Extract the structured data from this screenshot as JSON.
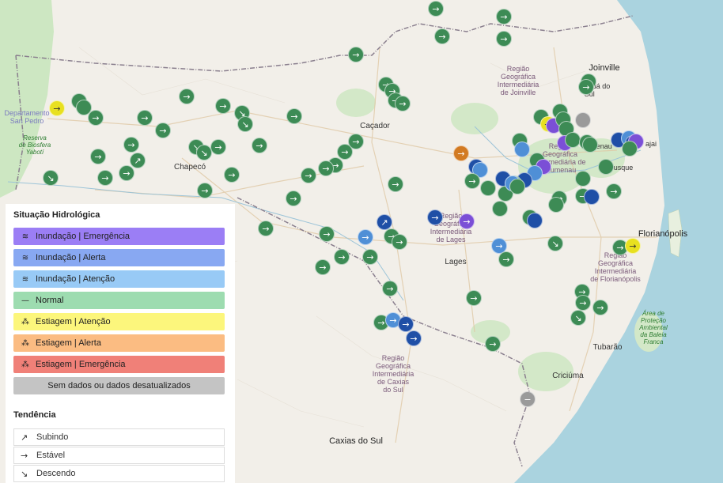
{
  "colors": {
    "normal": "#3d8b55",
    "emergencia_inund": "#7b4fd6",
    "alerta_inund": "#1f4fa6",
    "atencao_inund": "#4f8fd6",
    "estiagem_atencao": "#e8e020",
    "estiagem_alerta": "#d27a22",
    "sem_dados": "#9a9a9a"
  },
  "map_labels": {
    "regions": [
      {
        "text": "Região\nGeográfica\nIntermediária\nde Joinville"
      },
      {
        "text": "Região\nGeográfica\nIntermediária de\nBlumenau"
      },
      {
        "text": "Região\nGeográfica\nIntermediária\nde Lages"
      },
      {
        "text": "Região\nGeográfica\nIntermediária\nde Florianópolis"
      },
      {
        "text": "Região\nGeográfica\nIntermediária\nde Caxias\ndo Sul"
      }
    ],
    "cities": {
      "joinville": "Joinville",
      "jaragua": "aguá do\nSul",
      "cacador": "Caçador",
      "chapeco": "Chapecó",
      "lages": "Lages",
      "florianopolis": "Florianópolis",
      "tubarao": "Tubarão",
      "criciuma": "Criciúma",
      "caxias": "Caxias do Sul",
      "departamento": "Departamento\nSan Pedro",
      "usque": "usque",
      "menau": "menau",
      "ajai": "ajai"
    },
    "reserves": {
      "biosfera": "Reserva\nde Biosfera\nYabotí",
      "baleia": "Área de\nProteção\nAmbiental\nda Baleia\nFranca"
    }
  },
  "legend": {
    "title": "Situação Hidrológica",
    "items": [
      {
        "label": "Inundação | Emergência",
        "color": "#9b7ef5",
        "icon": "flood-icon"
      },
      {
        "label": "Inundação | Alerta",
        "color": "#88a8f2",
        "icon": "flood-icon"
      },
      {
        "label": "Inundação | Atenção",
        "color": "#98caf6",
        "icon": "flood-icon"
      },
      {
        "label": "Normal",
        "color": "#9ddcb0",
        "icon": "dash-icon"
      },
      {
        "label": "Estiagem | Atenção",
        "color": "#fcf67c",
        "icon": "drought-icon"
      },
      {
        "label": "Estiagem | Alerta",
        "color": "#fbbc82",
        "icon": "drought-icon"
      },
      {
        "label": "Estiagem | Emergência",
        "color": "#f08078",
        "icon": "drought-icon"
      },
      {
        "label": "Sem dados ou dados desatualizados",
        "color": "#c4c4c4",
        "icon": ""
      }
    ]
  },
  "trend": {
    "title": "Tendência",
    "items": [
      {
        "label": "Subindo",
        "icon": "trend-up-icon",
        "glyph": "↗"
      },
      {
        "label": "Estável",
        "icon": "arrow-right-icon",
        "glyph": "→"
      },
      {
        "label": "Descendo",
        "icon": "trend-down-icon",
        "glyph": "↘"
      }
    ]
  }
}
